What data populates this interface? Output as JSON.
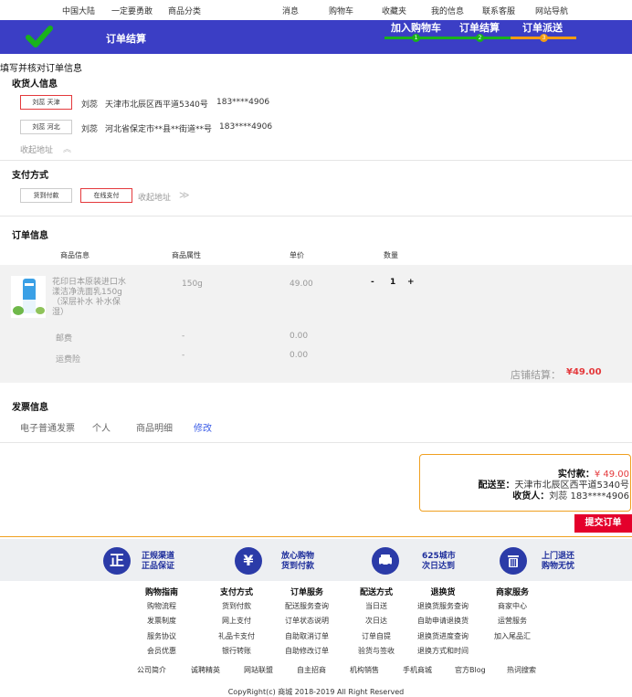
{
  "topnav": {
    "left": [
      "中国大陆",
      "一定要勇敢",
      "商品分类"
    ],
    "right": [
      "消息",
      "购物车",
      "收藏夹",
      "我的信息",
      "联系客服",
      "网站导航"
    ]
  },
  "header": {
    "title": "订单结算",
    "steps": [
      "加入购物车",
      "订单结算",
      "订单派送"
    ],
    "step_numbers": [
      "1",
      "2",
      "3"
    ]
  },
  "page_heading": "填写并核对订单信息",
  "receiver": {
    "title": "收货人信息",
    "addresses": [
      {
        "tag": "刘蕊 天津",
        "name": "刘蕊",
        "address": "天津市北辰区西平道5340号",
        "phone": "183****4906",
        "selected": true
      },
      {
        "tag": "刘蕊 河北",
        "name": "刘蕊",
        "address": "河北省保定市**县**街道**号",
        "phone": "183****4906",
        "selected": false
      }
    ],
    "collapse_label": "收起地址",
    "collapse_icon": "︽"
  },
  "payment": {
    "title": "支付方式",
    "options": [
      "货到付款",
      "在线支付"
    ],
    "selected": "在线支付",
    "collapse_label": "收起地址",
    "collapse_icon": "≫"
  },
  "order": {
    "title": "订单信息",
    "columns": [
      "商品信息",
      "商品属性",
      "单价",
      "数量"
    ],
    "item": {
      "name": "花印日本原装进口水漾洁净洗面乳150g（深层补水 补水保湿）",
      "attr": "150g",
      "price": "49.00",
      "quantity": "1",
      "minus": "-",
      "plus": "+"
    },
    "fees": [
      {
        "label": "邮费",
        "attr": "-",
        "price": "0.00"
      },
      {
        "label": "运费险",
        "attr": "-",
        "price": "0.00"
      }
    ],
    "shop_total_label": "店铺结算：",
    "shop_total": "¥49.00"
  },
  "invoice": {
    "title": "发票信息",
    "items": [
      "电子普通发票",
      "个人",
      "商品明细"
    ],
    "edit": "修改"
  },
  "summary": {
    "paid_label": "实付款：",
    "paid_value": "¥ 49.00",
    "ship_label": "配送至：",
    "ship_value": "天津市北辰区西平道5340号",
    "receiver_label": "收货人：",
    "receiver_value": "刘蕊 183****4906"
  },
  "submit_label": "提交订单",
  "footer": {
    "guarantees": [
      {
        "icon": "正",
        "l1": "正规渠道",
        "l2": "正品保证"
      },
      {
        "icon": "¥",
        "l1": "放心购物",
        "l2": "货到付款"
      },
      {
        "icon": "🚗",
        "l1": "625城市",
        "l2": "次日达到"
      },
      {
        "icon": "🗑",
        "l1": "上门退还",
        "l2": "购物无忧"
      }
    ],
    "columns": [
      {
        "head": "购物指南",
        "items": [
          "购物流程",
          "发票制度",
          "服务协议",
          "会员优惠"
        ]
      },
      {
        "head": "支付方式",
        "items": [
          "货到付款",
          "网上支付",
          "礼品卡支付",
          "银行转账"
        ]
      },
      {
        "head": "订单服务",
        "items": [
          "配送服务查询",
          "订单状态说明",
          "自助取消订单",
          "自助修改订单"
        ]
      },
      {
        "head": "配送方式",
        "items": [
          "当日送",
          "次日达",
          "订单自提",
          "验货与签收"
        ]
      },
      {
        "head": "退换货",
        "items": [
          "退换货服务查询",
          "自助申请退换货",
          "退换货进度查询",
          "退换方式和时间"
        ]
      },
      {
        "head": "商家服务",
        "items": [
          "商家中心",
          "运营服务",
          "加入尾品汇"
        ]
      }
    ],
    "links": [
      "公司简介",
      "诚聘精英",
      "网站联盟",
      "自主招商",
      "机构销售",
      "手机商城",
      "官方Blog",
      "热词搜索"
    ],
    "copyright": "CopyRight(c) 商城 2018-2019 All Right Reserved"
  },
  "colors": {
    "brand_blue": "#3b3ec5",
    "accent_red": "#e4393c",
    "progress_green": "#19b21b",
    "progress_orange": "#f39c12"
  }
}
